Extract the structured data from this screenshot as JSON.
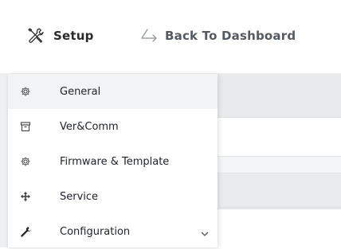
{
  "header": {
    "setup_label": "Setup",
    "back_label": "Back To Dashboard",
    "setup_icon": "wrench-screwdriver-icon",
    "back_icon": "return-arrow-icon"
  },
  "menu": {
    "items": [
      {
        "label": "General",
        "icon": "gear-icon",
        "active": true
      },
      {
        "label": "Ver&Comm",
        "icon": "archive-box-icon",
        "active": false
      },
      {
        "label": "Firmware & Template",
        "icon": "gear-icon",
        "active": false
      },
      {
        "label": "Service",
        "icon": "move-arrows-icon",
        "active": false
      },
      {
        "label": "Configuration",
        "icon": "wrench-icon",
        "active": false,
        "has_submenu": true
      }
    ]
  },
  "colors": {
    "text": "#1e2228",
    "active_bg": "#f2f3f4",
    "background_panel": "#eef0f2"
  }
}
